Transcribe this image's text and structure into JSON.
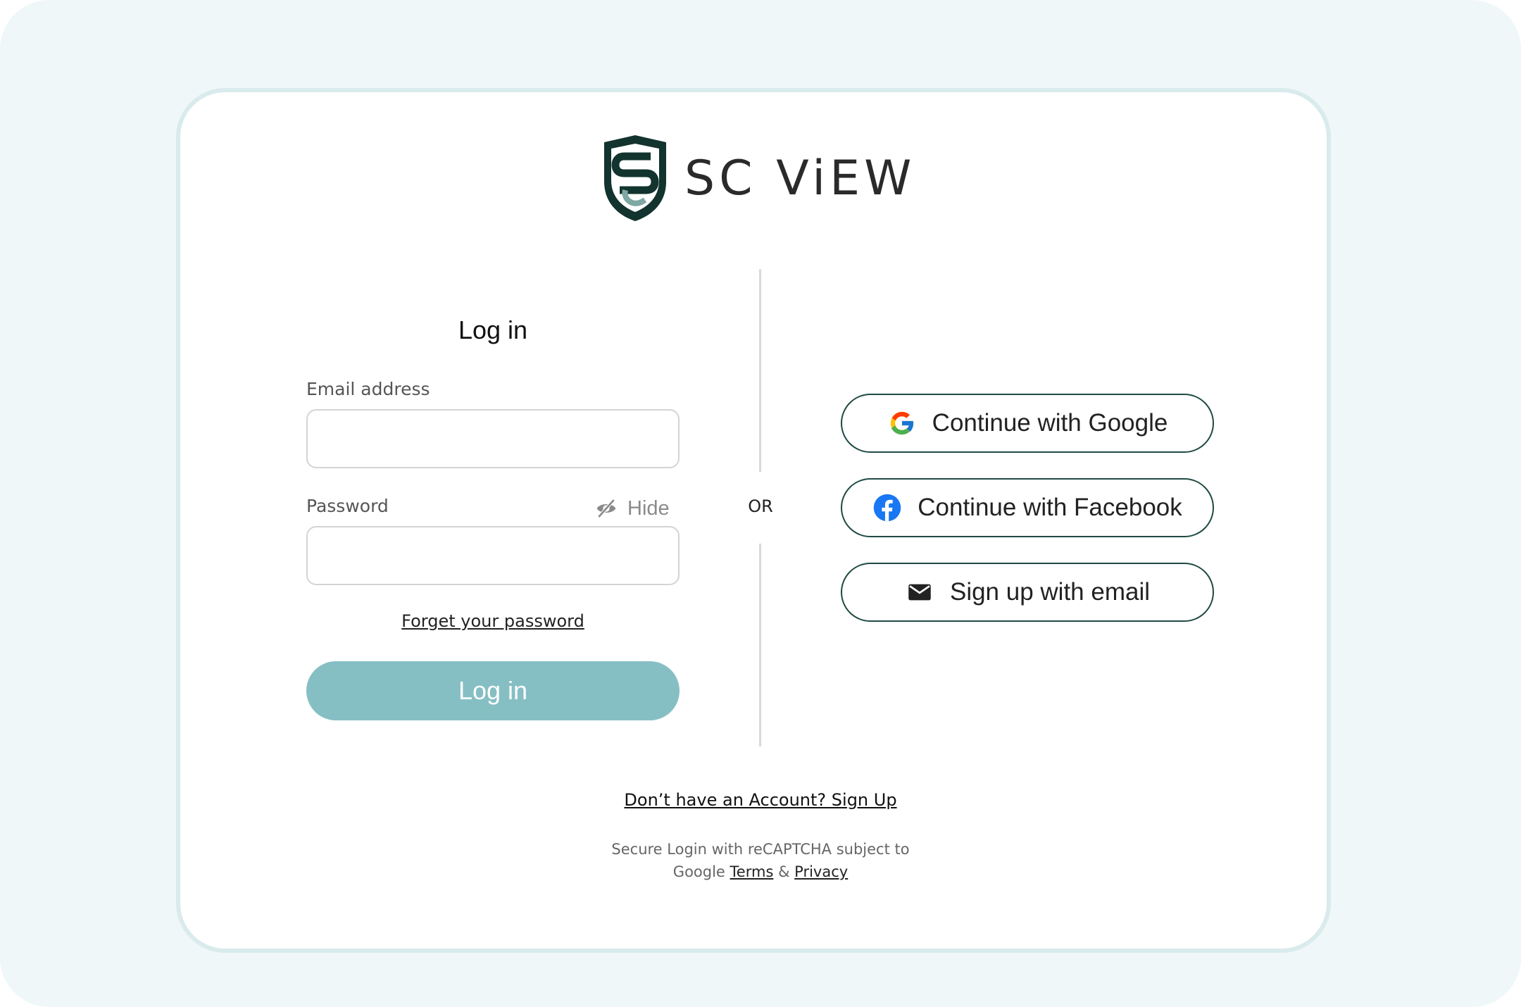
{
  "brand": {
    "name": "SC ViEW",
    "primary_color": "#12332e",
    "accent_color": "#86bfc3"
  },
  "login": {
    "title": "Log in",
    "email_label": "Email address",
    "email_value": "",
    "password_label": "Password",
    "password_value": "",
    "hide_label": "Hide",
    "forgot_label": "Forget your password",
    "submit_label": "Log in"
  },
  "divider": {
    "or_label": "OR"
  },
  "social": {
    "google_label": "Continue with Google",
    "facebook_label": "Continue with Facebook",
    "email_label": "Sign up with email"
  },
  "footer": {
    "signup_text": "Don’t have an Account? Sign Up",
    "recaptcha_line1": "Secure Login with reCAPTCHA subject to",
    "recaptcha_google": "Google",
    "terms_label": "Terms",
    "amp": "&",
    "privacy_label": "Privacy"
  },
  "icons": {
    "logo": "shield-logo-icon",
    "hide": "eye-slash-icon",
    "google": "google-g-icon",
    "facebook": "facebook-icon",
    "email": "envelope-icon"
  }
}
